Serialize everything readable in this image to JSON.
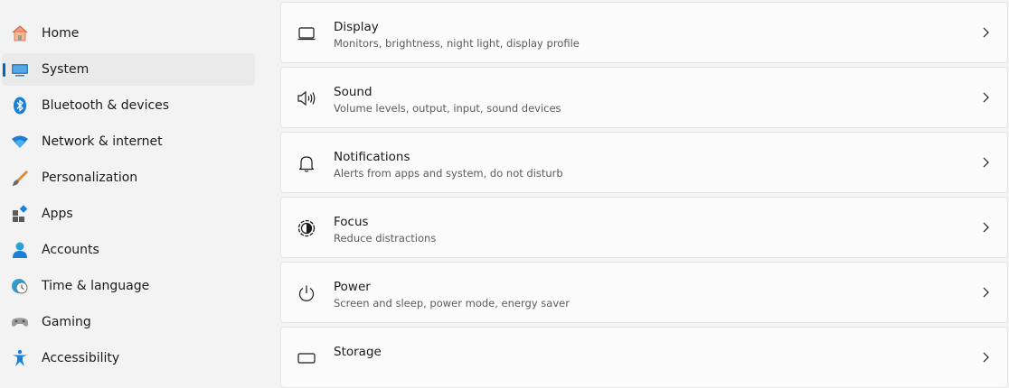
{
  "sidebar": {
    "items": [
      {
        "label": "Home",
        "icon": "home-icon"
      },
      {
        "label": "System",
        "icon": "system-icon",
        "active": true
      },
      {
        "label": "Bluetooth & devices",
        "icon": "bluetooth-icon"
      },
      {
        "label": "Network & internet",
        "icon": "wifi-icon"
      },
      {
        "label": "Personalization",
        "icon": "brush-icon"
      },
      {
        "label": "Apps",
        "icon": "apps-icon"
      },
      {
        "label": "Accounts",
        "icon": "account-icon"
      },
      {
        "label": "Time & language",
        "icon": "clock-globe-icon"
      },
      {
        "label": "Gaming",
        "icon": "gamepad-icon"
      },
      {
        "label": "Accessibility",
        "icon": "accessibility-icon"
      }
    ]
  },
  "settings": [
    {
      "title": "Display",
      "description": "Monitors, brightness, night light, display profile",
      "icon": "monitor-icon"
    },
    {
      "title": "Sound",
      "description": "Volume levels, output, input, sound devices",
      "icon": "speaker-icon"
    },
    {
      "title": "Notifications",
      "description": "Alerts from apps and system, do not disturb",
      "icon": "bell-icon"
    },
    {
      "title": "Focus",
      "description": "Reduce distractions",
      "icon": "focus-icon"
    },
    {
      "title": "Power",
      "description": "Screen and sleep, power mode, energy saver",
      "icon": "power-icon"
    },
    {
      "title": "Storage",
      "description": "",
      "icon": "storage-icon"
    }
  ],
  "colors": {
    "accent": "#0067c0",
    "background": "#f3f3f3",
    "card": "#fbfbfb"
  }
}
